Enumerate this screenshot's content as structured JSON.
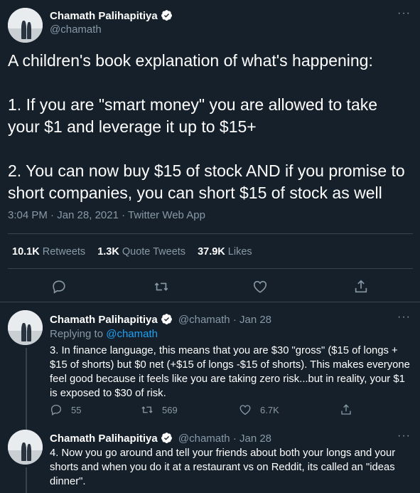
{
  "main_tweet": {
    "author_name": "Chamath Palihapitiya",
    "author_handle": "@chamath",
    "more_label": "···",
    "text": "A children's book explanation of what's happening:\n\n1. If you are \"smart money\" you are allowed to take your $1 and leverage it up to $15+\n\n2. You can now buy $15 of stock AND if you promise to short companies, you can short $15 of stock as well",
    "timestamp": "3:04 PM · Jan 28, 2021 · Twitter Web App",
    "stats": {
      "retweets_count": "10.1K",
      "retweets_label": "Retweets",
      "quotes_count": "1.3K",
      "quotes_label": "Quote Tweets",
      "likes_count": "37.9K",
      "likes_label": "Likes"
    }
  },
  "replies": [
    {
      "author_name": "Chamath Palihapitiya",
      "author_handle": "@chamath",
      "date": "· Jan 28",
      "replying_prefix": "Replying to",
      "replying_to": "@chamath",
      "text": "3. In finance language, this means that you are $30 \"gross\" ($15 of longs + $15 of shorts) but $0 net (+$15 of longs -$15 of shorts). This makes everyone feel good because it feels like you are taking zero risk...but in reality, your $1 is exposed to $30 of risk.",
      "reply_count": "55",
      "retweet_count": "569",
      "like_count": "6.7K"
    },
    {
      "author_name": "Chamath Palihapitiya",
      "author_handle": "@chamath",
      "date": "· Jan 28",
      "text": "4. Now you go around and tell your friends about both your longs and your shorts and when you do it at a restaurant vs on Reddit, its called an \"ideas dinner\"."
    }
  ],
  "colors": {
    "background": "#15202b",
    "secondary_text": "#8899a6",
    "accent": "#1da1f2",
    "divider": "#38444d"
  },
  "icons": [
    "verified-badge-icon",
    "reply-icon",
    "retweet-icon",
    "like-icon",
    "share-icon",
    "more-icon"
  ]
}
